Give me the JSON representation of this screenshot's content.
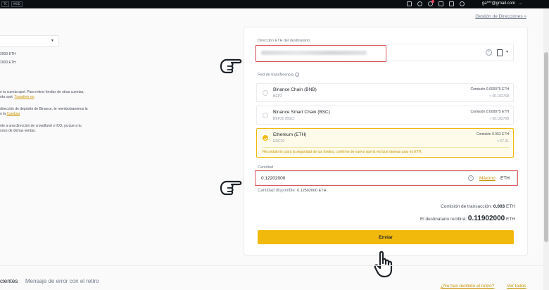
{
  "topbar": {
    "badges": [
      "TC",
      "MGD"
    ],
    "email": "ga***@gmail.com",
    "more": "..."
  },
  "header": {
    "manage_addresses": "Gestión de Direcciones »"
  },
  "left": {
    "line1": "2000 ETH",
    "line2": "2000 ETH",
    "p1a": "e tu cuenta spot. Para retirar fondos de otras cuentas,",
    "p1b": "nta spot.",
    "p1_link": "Transferir en",
    "p2a": "dirección de depósito de Binance, te reembolsaremos la",
    "p2b": "o la",
    "p2_link": "Cambiar",
    "p3a": "nte a una dirección de crowdfund o ICO, ya que a tu",
    "p3b": "ceso de dichas ventas."
  },
  "form": {
    "address_label": "Dirección ETH del destinatario",
    "network_label": "Red de transferencia",
    "networks": [
      {
        "name": "Binance Chain (BNB)",
        "sub": "BEP2",
        "fee": "Comisión 0.000075 ETH",
        "fee_value": "≈ €0.182768"
      },
      {
        "name": "Binance Smart Chain (BSC)",
        "sub": "BEP20 (BSC)",
        "fee": "Comisión 0.000075 ETH",
        "fee_value": "≈ €0.182768"
      },
      {
        "name": "Ethereum (ETH)",
        "sub": "ERC20",
        "fee": "Comisión 0.003 ETH",
        "fee_value": "≈ €7.31"
      }
    ],
    "warning": "Recordatorio: para la seguridad de tus fondos, confirme de nuevo que la red que deseas usar es ETH.",
    "amount_label": "Cantidad",
    "amount_value": "0.12202000",
    "max_label": "Máximo",
    "unit": "ETH",
    "available_label": "Cantidad disponible:",
    "available_value": "0.12502000 ETH",
    "fee_label": "Comisión de transacción:",
    "fee_value": "0.003",
    "fee_unit": "ETH",
    "receive_label": "El destinatario recibirá:",
    "receive_value": "0.11902000",
    "receive_unit": "ETH",
    "send_button": "Enviar"
  },
  "bottom": {
    "tab1": "cientes",
    "tab2": "Mensaje de error con el retiro",
    "link1": "¿No has recibido el retiro?",
    "link2": "Ver todos"
  }
}
